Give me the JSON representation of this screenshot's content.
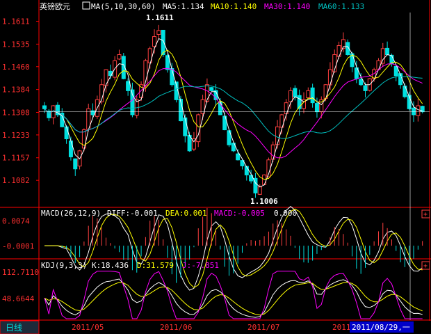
{
  "header": {
    "symbol": "英镑欧元",
    "ma_label": "MA(5,10,30,60)",
    "ma5": "MA5:1.134",
    "ma10": "MA10:1.140",
    "ma30": "MA30:1.140",
    "ma60": "MA60:1.133"
  },
  "macd_header": {
    "label": "MACD(26,12,9)",
    "diff": "DIFF:-0.001",
    "dea": "DEA:0.001",
    "macd": "MACD:-0.005",
    "extra": "0.000"
  },
  "kdj_header": {
    "label": "KDJ(9,3,3)",
    "k": "K:18.436",
    "d": "D:31.579",
    "j": "J:-7.851"
  },
  "annotations": {
    "high": "1.1611",
    "low": "1.1006"
  },
  "footer": {
    "period_button": "日线",
    "dates": [
      "2011/05",
      "2011/06",
      "2011/07",
      "2011/"
    ],
    "cursor_date": "2011/08/29,一"
  },
  "colors": {
    "up": "#ff4040",
    "down": "#00e0e0",
    "ma5": "#ffffff",
    "ma10": "#ffff00",
    "ma30": "#ff00ff",
    "ma60": "#00c0c0",
    "axis": "#ff0000",
    "label_text": "#ff3030"
  },
  "chart_data": {
    "type": "candlestick",
    "price_axis": {
      "ticks": [
        "1.1611",
        "1.1535",
        "1.1460",
        "1.1384",
        "1.1308",
        "1.1233",
        "1.1157",
        "1.1082"
      ],
      "ylim": [
        1.1006,
        1.164
      ]
    },
    "macd_axis": {
      "ticks": [
        "0.0074",
        "-0.0001"
      ],
      "ylim": [
        -0.0035,
        0.0085
      ]
    },
    "kdj_axis": {
      "ticks": [
        "112.7110",
        "48.6644"
      ],
      "ylim": [
        0,
        118
      ]
    },
    "closes": [
      1.132,
      1.129,
      1.133,
      1.13,
      1.126,
      1.122,
      1.116,
      1.112,
      1.118,
      1.125,
      1.132,
      1.13,
      1.135,
      1.14,
      1.145,
      1.143,
      1.148,
      1.15,
      1.142,
      1.138,
      1.13,
      1.135,
      1.14,
      1.148,
      1.152,
      1.156,
      1.158,
      1.15,
      1.145,
      1.14,
      1.135,
      1.128,
      1.123,
      1.118,
      1.122,
      1.13,
      1.135,
      1.14,
      1.138,
      1.135,
      1.13,
      1.125,
      1.12,
      1.118,
      1.115,
      1.113,
      1.11,
      1.108,
      1.104,
      1.106,
      1.11,
      1.115,
      1.12,
      1.126,
      1.13,
      1.134,
      1.138,
      1.136,
      1.132,
      1.135,
      1.138,
      1.134,
      1.131,
      1.135,
      1.14,
      1.145,
      1.15,
      1.153,
      1.155,
      1.15,
      1.146,
      1.142,
      1.14,
      1.138,
      1.142,
      1.145,
      1.148,
      1.152,
      1.15,
      1.147,
      1.143,
      1.14,
      1.136,
      1.132,
      1.13,
      1.133,
      1.131
    ],
    "macd_series": {
      "diff": "white line",
      "dea": "yellow line",
      "bars": "red/green histogram"
    },
    "kdj_series": {
      "k": "white line",
      "d": "yellow line",
      "j": "magenta line"
    }
  }
}
